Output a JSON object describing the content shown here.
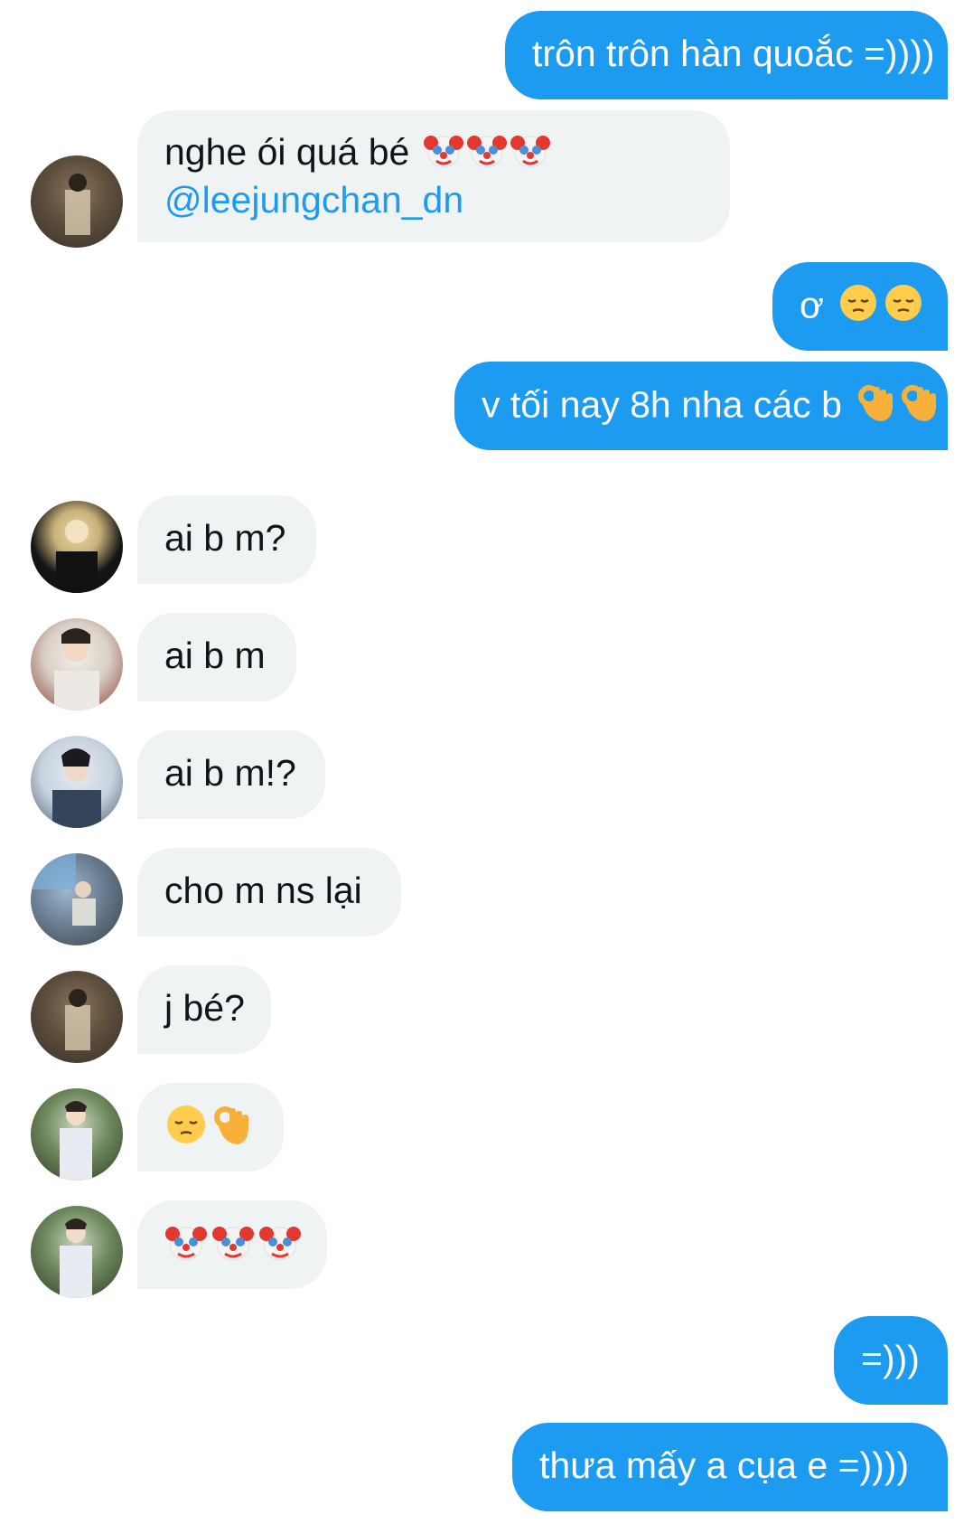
{
  "messages": [
    {
      "side": "out",
      "text": "trôn trôn hàn quoắc =))))",
      "emoji": []
    },
    {
      "side": "in",
      "text": "nghe ói quá bé",
      "emoji": [
        "clown-face",
        "clown-face",
        "clown-face"
      ],
      "mention": "@leejungchan_dn",
      "avatar": "avatar-plaid-outdoor"
    },
    {
      "side": "out",
      "text": "ơ",
      "emoji": [
        "pensive-face",
        "pensive-face"
      ]
    },
    {
      "side": "out",
      "text": "v tối nay 8h nha các b",
      "emoji": [
        "ok-hand",
        "ok-hand"
      ]
    },
    {
      "side": "in",
      "text": "ai b m?",
      "emoji": [],
      "avatar": "avatar-blonde-black-jacket"
    },
    {
      "side": "in",
      "text": "ai b m",
      "emoji": [],
      "avatar": "avatar-glasses-white-shirt"
    },
    {
      "side": "in",
      "text": "ai b m!?",
      "emoji": [],
      "avatar": "avatar-denim-jacket"
    },
    {
      "side": "in",
      "text": "cho m ns lại",
      "emoji": [],
      "avatar": "avatar-sitting-wall"
    },
    {
      "side": "in",
      "text": "j bé?",
      "emoji": [],
      "avatar": "avatar-plaid-outdoor"
    },
    {
      "side": "in",
      "text": "",
      "emoji": [
        "pensive-face",
        "ok-hand"
      ],
      "avatar": "avatar-white-outfit-greenery"
    },
    {
      "side": "in",
      "text": "",
      "emoji": [
        "clown-face",
        "clown-face",
        "clown-face"
      ],
      "avatar": "avatar-white-outfit-greenery"
    },
    {
      "side": "out",
      "text": "=)))",
      "emoji": []
    },
    {
      "side": "out",
      "text": "thưa mấy a cụa e =))))",
      "emoji": []
    }
  ],
  "colors": {
    "outgoing_bubble": "#1d9bf0",
    "incoming_bubble": "#eff3f4",
    "mention": "#1d9bf0"
  }
}
